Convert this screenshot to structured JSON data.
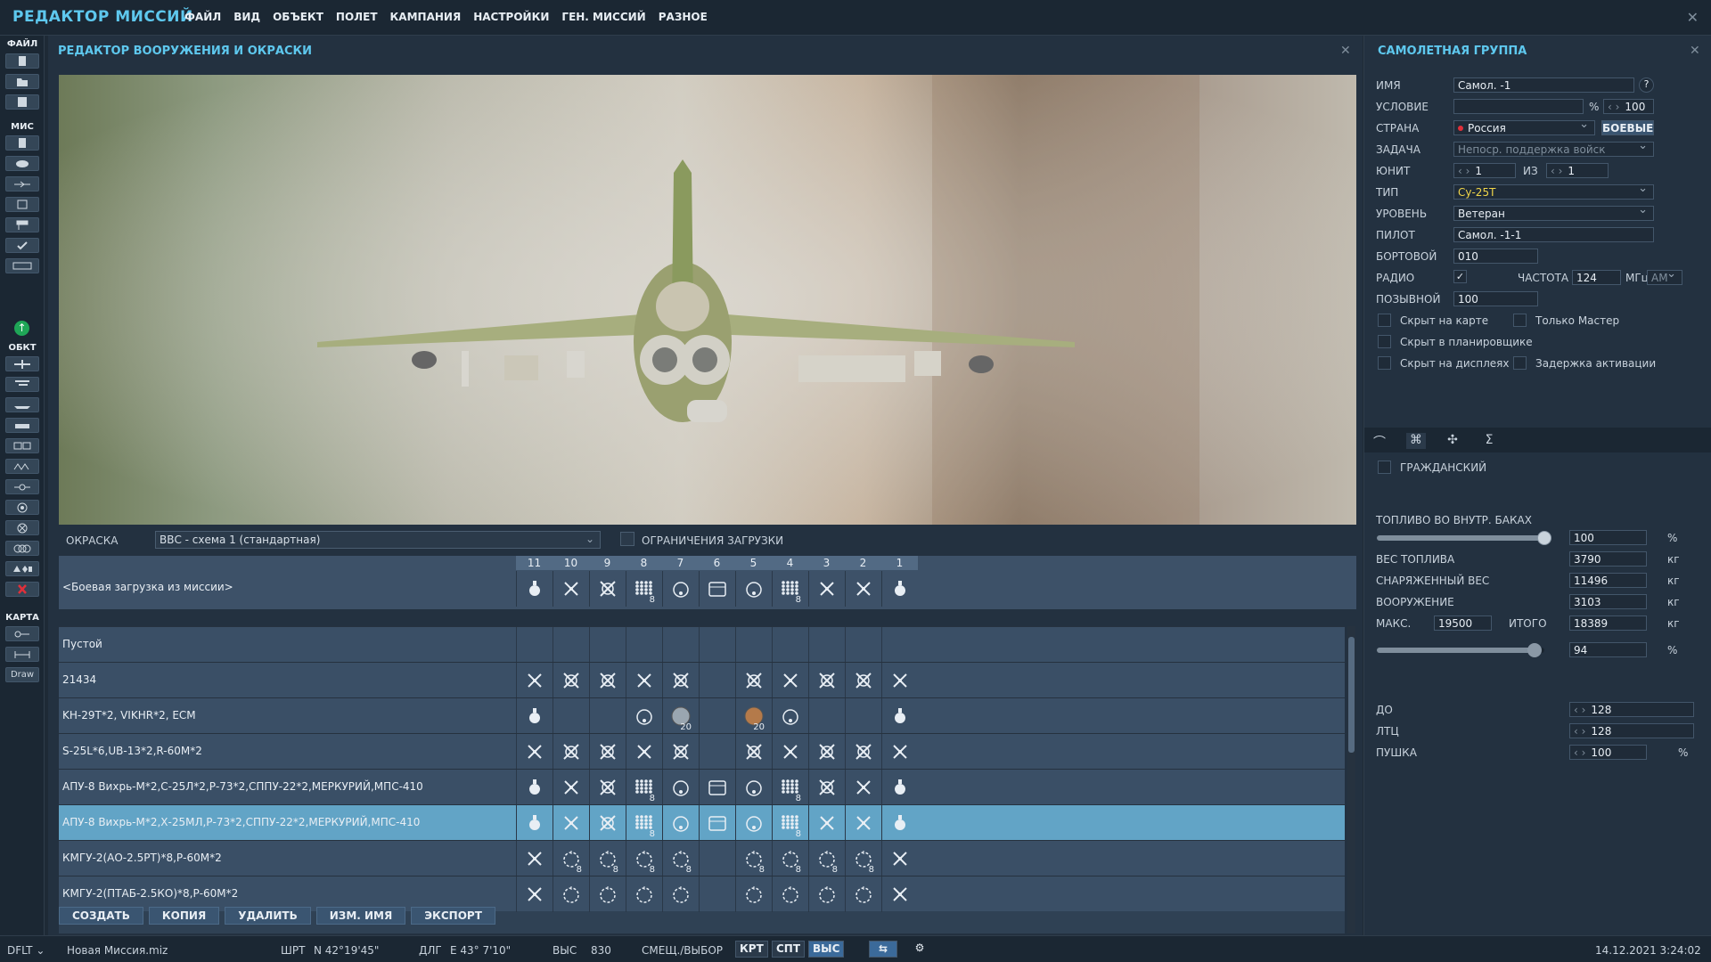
{
  "app": {
    "title": "РЕДАКТОР МИССИЙ"
  },
  "menu": [
    "ФАЙЛ",
    "ВИД",
    "ОБЪЕКТ",
    "ПОЛЕТ",
    "КАМПАНИЯ",
    "НАСТРОЙКИ",
    "ГЕН. МИССИЙ",
    "РАЗНОЕ"
  ],
  "toolbar": {
    "file_label": "ФАЙЛ",
    "mission_label": "МИС",
    "objects_label": "ОБКТ",
    "map_label": "КАРТА",
    "draw_label": "Draw"
  },
  "weapons_panel": {
    "title": "РЕДАКТОР ВООРУЖЕНИЯ И ОКРАСКИ",
    "skin_label": "ОКРАСКА",
    "skin_value": "ВВС - схема 1 (стандартная)",
    "limits_label": "ОГРАНИЧЕНИЯ ЗАГРУЗКИ",
    "pylons": [
      "11",
      "10",
      "9",
      "8",
      "7",
      "6",
      "5",
      "4",
      "3",
      "2",
      "1"
    ],
    "mission_loadout": {
      "name": "<Боевая загрузка из миссии>",
      "cells": [
        [
          "bomb",
          ""
        ],
        [
          "x",
          ""
        ],
        [
          "xc",
          ""
        ],
        [
          "dots",
          "8"
        ],
        [
          "pod",
          ""
        ],
        [
          "box",
          ""
        ],
        [
          "pod",
          ""
        ],
        [
          "dots",
          "8"
        ],
        [
          "x",
          ""
        ],
        [
          "x",
          ""
        ],
        [
          "bomb",
          ""
        ]
      ]
    },
    "loadouts": [
      {
        "name": "Пустой",
        "cells": [
          [
            "",
            ""
          ],
          [
            "",
            ""
          ],
          [
            "",
            ""
          ],
          [
            "",
            ""
          ],
          [
            "",
            ""
          ],
          [
            "",
            ""
          ],
          [
            "",
            ""
          ],
          [
            "",
            ""
          ],
          [
            "",
            ""
          ],
          [
            "",
            ""
          ],
          [
            "",
            ""
          ]
        ]
      },
      {
        "name": "21434",
        "cells": [
          [
            "x",
            ""
          ],
          [
            "xc",
            ""
          ],
          [
            "xc",
            ""
          ],
          [
            "x",
            ""
          ],
          [
            "xc",
            ""
          ],
          [
            "",
            ""
          ],
          [
            "xc",
            ""
          ],
          [
            "x",
            ""
          ],
          [
            "xc",
            ""
          ],
          [
            "xc",
            ""
          ],
          [
            "x",
            ""
          ]
        ]
      },
      {
        "name": "KH-29T*2, VIKHR*2, ECM",
        "cells": [
          [
            "bomb",
            ""
          ],
          [
            "",
            ""
          ],
          [
            "",
            ""
          ],
          [
            "pod",
            ""
          ],
          [
            "cluster",
            "20"
          ],
          [
            "",
            ""
          ],
          [
            "clusterB",
            "20"
          ],
          [
            "pod",
            ""
          ],
          [
            "",
            ""
          ],
          [
            "",
            ""
          ],
          [
            "bomb",
            ""
          ]
        ]
      },
      {
        "name": "S-25L*6,UB-13*2,R-60M*2",
        "cells": [
          [
            "x",
            ""
          ],
          [
            "xc",
            ""
          ],
          [
            "xc",
            ""
          ],
          [
            "x",
            ""
          ],
          [
            "xc",
            ""
          ],
          [
            "",
            ""
          ],
          [
            "xc",
            ""
          ],
          [
            "x",
            ""
          ],
          [
            "xc",
            ""
          ],
          [
            "xc",
            ""
          ],
          [
            "x",
            ""
          ]
        ]
      },
      {
        "name": "АПУ-8 Вихрь-М*2,С-25Л*2,Р-73*2,СППУ-22*2,МЕРКУРИЙ,МПС-410",
        "cells": [
          [
            "bomb",
            ""
          ],
          [
            "x",
            ""
          ],
          [
            "xc",
            ""
          ],
          [
            "dots",
            "8"
          ],
          [
            "pod",
            ""
          ],
          [
            "box",
            ""
          ],
          [
            "pod",
            ""
          ],
          [
            "dots",
            "8"
          ],
          [
            "xc",
            ""
          ],
          [
            "x",
            ""
          ],
          [
            "bomb",
            ""
          ]
        ]
      },
      {
        "name": "АПУ-8 Вихрь-М*2,Х-25МЛ,Р-73*2,СППУ-22*2,МЕРКУРИЙ,МПС-410",
        "cells": [
          [
            "bomb",
            ""
          ],
          [
            "x",
            ""
          ],
          [
            "xc",
            ""
          ],
          [
            "dots",
            "8"
          ],
          [
            "pod",
            ""
          ],
          [
            "box",
            ""
          ],
          [
            "pod",
            ""
          ],
          [
            "dots",
            "8"
          ],
          [
            "x",
            ""
          ],
          [
            "x",
            ""
          ],
          [
            "bomb",
            ""
          ]
        ]
      },
      {
        "name": "КМГУ-2(АО-2.5РТ)*8,Р-60М*2",
        "cells": [
          [
            "x",
            ""
          ],
          [
            "ring",
            "8"
          ],
          [
            "ring",
            "8"
          ],
          [
            "ring",
            "8"
          ],
          [
            "ring",
            "8"
          ],
          [
            "",
            ""
          ],
          [
            "ring",
            "8"
          ],
          [
            "ring",
            "8"
          ],
          [
            "ring",
            "8"
          ],
          [
            "ring",
            "8"
          ],
          [
            "x",
            ""
          ]
        ]
      },
      {
        "name": "КМГУ-2(ПТАБ-2.5КО)*8,Р-60М*2",
        "cells": [
          [
            "x",
            ""
          ],
          [
            "ring",
            ""
          ],
          [
            "ring",
            ""
          ],
          [
            "ring",
            ""
          ],
          [
            "ring",
            ""
          ],
          [
            "",
            ""
          ],
          [
            "ring",
            ""
          ],
          [
            "ring",
            ""
          ],
          [
            "ring",
            ""
          ],
          [
            "ring",
            ""
          ],
          [
            "x",
            ""
          ]
        ]
      }
    ],
    "selected_index": 5,
    "buttons": {
      "create": "СОЗДАТЬ",
      "copy": "КОПИЯ",
      "delete": "УДАЛИТЬ",
      "rename": "ИЗМ. ИМЯ",
      "export": "ЭКСПОРТ"
    }
  },
  "group_panel": {
    "title": "САМОЛЕТНАЯ ГРУППА",
    "name_label": "ИМЯ",
    "name_value": "Самол. -1",
    "help": "?",
    "condition_label": "УСЛОВИЕ",
    "condition_value": "",
    "condition_pct": "%",
    "condition_prob": "100",
    "country_label": "СТРАНА",
    "country_value": "Россия",
    "combat_button": "БОЕВЫЕ",
    "task_label": "ЗАДАЧА",
    "task_value": "Непоср. поддержка войск",
    "unit_label": "ЮНИТ",
    "unit_value": "1",
    "of_label": "ИЗ",
    "unit_total": "1",
    "type_label": "ТИП",
    "type_value": "Су-25Т",
    "skill_label": "УРОВЕНЬ",
    "skill_value": "Ветеран",
    "pilot_label": "ПИЛОТ",
    "pilot_value": "Самол. -1-1",
    "tail_label": "БОРТОВОЙ",
    "tail_value": "010",
    "radio_label": "РАДИО",
    "freq_label": "ЧАСТОТА",
    "freq_value": "124",
    "freq_unit": "МГц",
    "modulation": "AM",
    "callsign_label": "ПОЗЫВНОЙ",
    "callsign_value": "100",
    "hidden_map": "Скрыт на карте",
    "master_only": "Только Мастер",
    "hidden_planner": "Скрыт в планировщике",
    "hidden_mfd": "Скрыт на дисплеях",
    "late_activation": "Задержка активации",
    "tabs": [
      "route-icon",
      "loadout-icon",
      "drone-icon",
      "sum-icon"
    ],
    "civil_label": "ГРАЖДАНСКИЙ",
    "fuel_label": "ТОПЛИВО ВО ВНУТР. БАКАХ",
    "fuel_value": "100",
    "fuel_pct": "%",
    "fuel_fraction": 1.0,
    "fuel_weight_label": "ВЕС ТОПЛИВА",
    "fuel_weight_value": "3790",
    "empty_weight_label": "СНАРЯЖЕННЫЙ ВЕС",
    "empty_weight_value": "11496",
    "weapons_label": "ВООРУЖЕНИЕ",
    "weapons_value": "3103",
    "max_label": "МАКС.",
    "max_value": "19500",
    "total_label": "ИТОГО",
    "total_value": "18389",
    "total_pct": "94",
    "total_fraction": 0.94,
    "kg": "кг",
    "pct": "%",
    "chaff_label": "ДО",
    "chaff_value": "128",
    "flare_label": "ЛТЦ",
    "flare_value": "128",
    "gun_label": "ПУШКА",
    "gun_value": "100",
    "gun_unit": "%"
  },
  "statusbar": {
    "mode": "DFLT",
    "file": "Новая Миссия.miz",
    "lat_label": "ШРТ",
    "lat_value": "N 42°19'45\"",
    "lon_label": "ДЛГ",
    "lon_value": "E 43° 7'10\"",
    "alt_label": "ВЫС",
    "alt_value": "830",
    "select_label": "СМЕЩ./ВЫБОР",
    "btn_map": "КРТ",
    "btn_sat": "СПТ",
    "btn_alt": "ВЫС",
    "datetime": "14.12.2021 3:24:02"
  },
  "colors": {
    "accent": "#5ec8ee",
    "selected_row": "#62a4c6",
    "panel": "#233140"
  }
}
